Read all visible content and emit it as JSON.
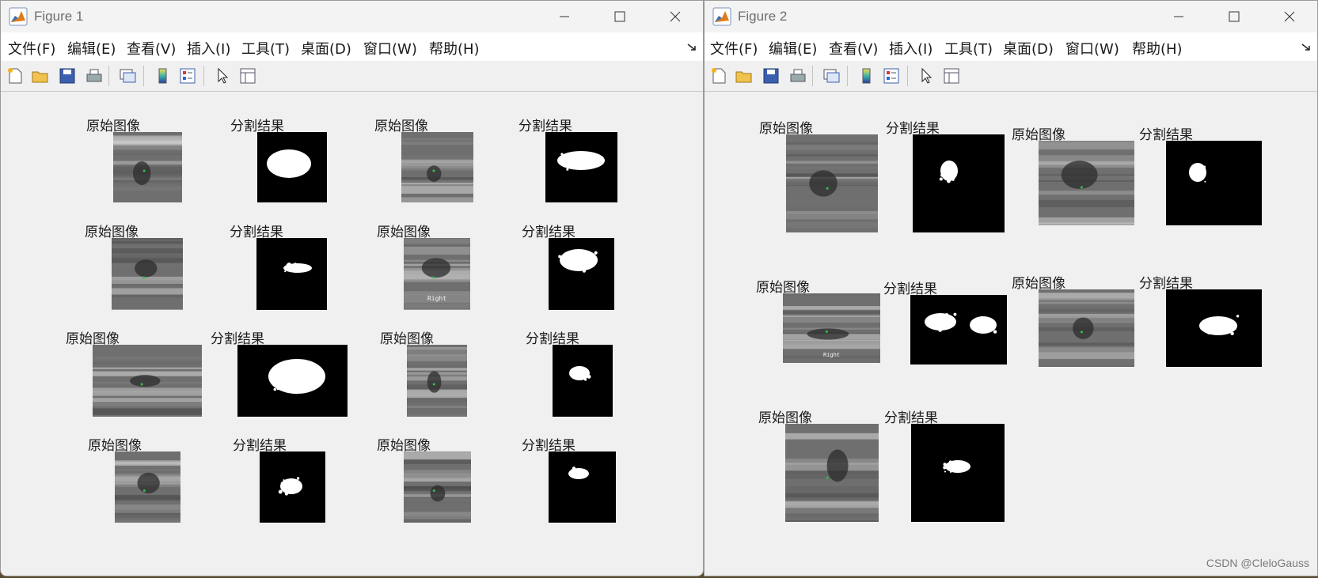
{
  "figure1": {
    "title": "Figure 1",
    "menu": [
      "文件(F)",
      "编辑(E)",
      "查看(V)",
      "插入(I)",
      "工具(T)",
      "桌面(D)",
      "窗口(W)",
      "帮助(H)"
    ],
    "subplots": [
      {
        "title": "原始图像",
        "type": "ultrasound"
      },
      {
        "title": "分割结果",
        "type": "mask"
      },
      {
        "title": "原始图像",
        "type": "ultrasound"
      },
      {
        "title": "分割结果",
        "type": "mask"
      },
      {
        "title": "原始图像",
        "type": "ultrasound"
      },
      {
        "title": "分割结果",
        "type": "mask"
      },
      {
        "title": "原始图像",
        "type": "ultrasound",
        "caption": "Right"
      },
      {
        "title": "分割结果",
        "type": "mask"
      },
      {
        "title": "原始图像",
        "type": "ultrasound"
      },
      {
        "title": "分割结果",
        "type": "mask"
      },
      {
        "title": "原始图像",
        "type": "ultrasound"
      },
      {
        "title": "分割结果",
        "type": "mask"
      },
      {
        "title": "原始图像",
        "type": "ultrasound"
      },
      {
        "title": "分割结果",
        "type": "mask"
      },
      {
        "title": "原始图像",
        "type": "ultrasound"
      },
      {
        "title": "分割结果",
        "type": "mask"
      }
    ]
  },
  "figure2": {
    "title": "Figure 2",
    "menu": [
      "文件(F)",
      "编辑(E)",
      "查看(V)",
      "插入(I)",
      "工具(T)",
      "桌面(D)",
      "窗口(W)",
      "帮助(H)"
    ],
    "subplots": [
      {
        "title": "原始图像",
        "type": "ultrasound"
      },
      {
        "title": "分割结果",
        "type": "mask"
      },
      {
        "title": "原始图像",
        "type": "ultrasound"
      },
      {
        "title": "分割结果",
        "type": "mask"
      },
      {
        "title": "原始图像",
        "type": "ultrasound",
        "caption": "Right"
      },
      {
        "title": "分割结果",
        "type": "mask"
      },
      {
        "title": "原始图像",
        "type": "ultrasound"
      },
      {
        "title": "分割结果",
        "type": "mask"
      },
      {
        "title": "原始图像",
        "type": "ultrasound"
      },
      {
        "title": "分割结果",
        "type": "mask"
      }
    ]
  },
  "toolbar_icons": [
    "new-figure-icon",
    "open-file-icon",
    "save-icon",
    "print-icon",
    "link-plot-icon",
    "colorbar-icon",
    "legend-icon",
    "edit-plot-icon",
    "property-inspector-icon"
  ],
  "colors": {
    "window_bg": "#f0f0f0",
    "menubar_bg": "#ffffff",
    "title_text": "#6e6e6e",
    "mask_bg": "#000000",
    "mask_fg": "#ffffff"
  },
  "watermark": "CSDN @CleloGauss"
}
